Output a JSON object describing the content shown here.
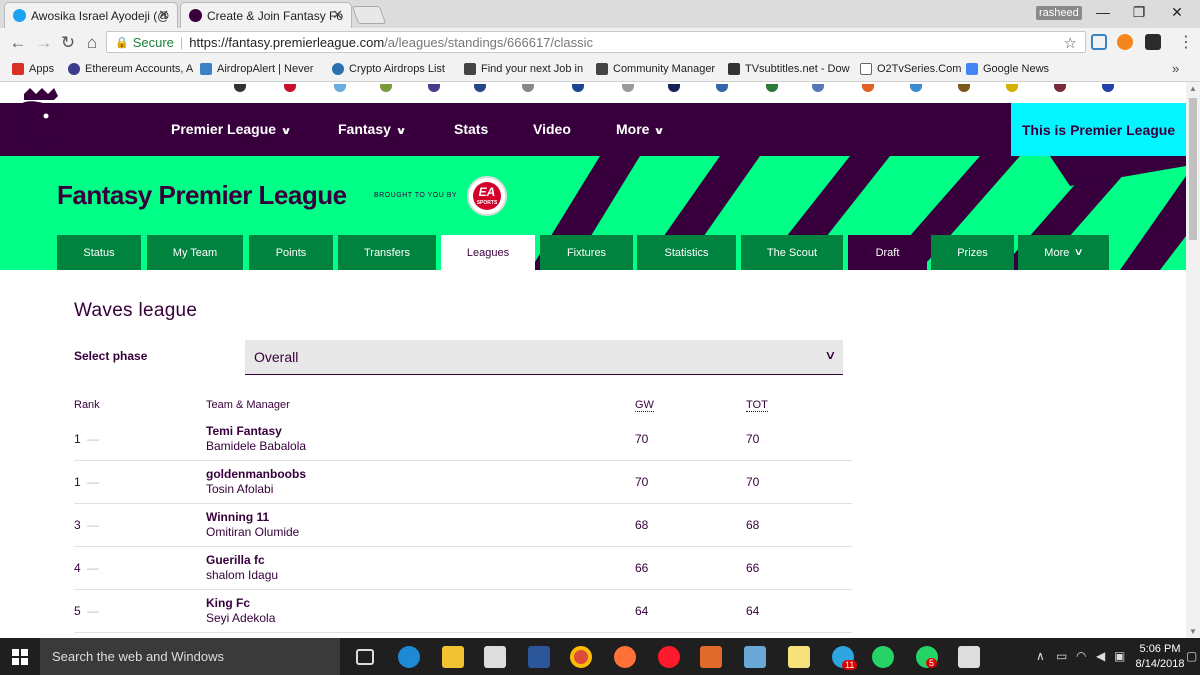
{
  "browser": {
    "tabs": [
      {
        "title": "Awosika Israel Ayodeji (@",
        "icon": "twitter-icon",
        "color": "#1da1f2"
      },
      {
        "title": "Create & Join Fantasy Fo",
        "icon": "premier-league-icon",
        "color": "#37003c"
      }
    ],
    "user": "rasheed",
    "minimize": "—",
    "restore": "❐",
    "close": "✕",
    "secure_label": "Secure",
    "url_host": "https://fantasy.premierleague.com",
    "url_path": "/a/leagues/standings/666617/classic",
    "bookmarks": [
      {
        "label": "Apps",
        "color": "#d93025"
      },
      {
        "label": "Ethereum Accounts, A",
        "color": "#3c3c8c"
      },
      {
        "label": "AirdropAlert | Never",
        "color": "#3b82c4"
      },
      {
        "label": "Crypto Airdrops List",
        "color": "#2a6fb0"
      },
      {
        "label": "Find your next Job in",
        "color": "#444"
      },
      {
        "label": "Community Manager",
        "color": "#444"
      },
      {
        "label": "TVsubtitles.net - Dow",
        "color": "#333"
      },
      {
        "label": "O2TvSeries.Com",
        "color": "#666"
      },
      {
        "label": "Google News",
        "color": "#4285f4"
      }
    ]
  },
  "site": {
    "nav": [
      {
        "label": "Premier League",
        "chevron": true
      },
      {
        "label": "Fantasy",
        "chevron": true
      },
      {
        "label": "Stats",
        "chevron": false
      },
      {
        "label": "Video",
        "chevron": false
      },
      {
        "label": "More",
        "chevron": true
      }
    ],
    "this_is": "This is Premier League",
    "fpl_title": "Fantasy Premier League",
    "brought_by": "BROUGHT TO YOU BY",
    "ea_text": "EA",
    "ea_sub": "SPORTS",
    "subnav": [
      {
        "label": "Status"
      },
      {
        "label": "My Team"
      },
      {
        "label": "Points"
      },
      {
        "label": "Transfers"
      },
      {
        "label": "Leagues"
      },
      {
        "label": "Fixtures"
      },
      {
        "label": "Statistics"
      },
      {
        "label": "The Scout"
      },
      {
        "label": "Draft"
      },
      {
        "label": "Prizes"
      },
      {
        "label": "More"
      }
    ],
    "active_tab": "Leagues"
  },
  "league": {
    "title": "Waves league",
    "phase_label": "Select phase",
    "phase_value": "Overall",
    "columns": {
      "rank": "Rank",
      "team": "Team & Manager",
      "gw": "GW",
      "tot": "TOT"
    },
    "rows": [
      {
        "rank": "1",
        "team": "Temi Fantasy",
        "manager": "Bamidele Babalola",
        "gw": "70",
        "tot": "70"
      },
      {
        "rank": "1",
        "team": "goldenmanboobs",
        "manager": "Tosin Afolabi",
        "gw": "70",
        "tot": "70"
      },
      {
        "rank": "3",
        "team": "Winning 11",
        "manager": "Omitiran Olumide",
        "gw": "68",
        "tot": "68"
      },
      {
        "rank": "4",
        "team": "Guerilla fc",
        "manager": "shalom Idagu",
        "gw": "66",
        "tot": "66"
      },
      {
        "rank": "5",
        "team": "King Fc",
        "manager": "Seyi Adekola",
        "gw": "64",
        "tot": "64"
      }
    ]
  },
  "taskbar": {
    "search_placeholder": "Search the web and Windows",
    "badges": [
      "11",
      "5"
    ],
    "time": "5:06 PM",
    "date": "8/14/2018"
  },
  "colors": {
    "purple": "#37003c",
    "green": "#00ff87",
    "cyan": "#04f5ff",
    "tab_green": "#00833e"
  }
}
